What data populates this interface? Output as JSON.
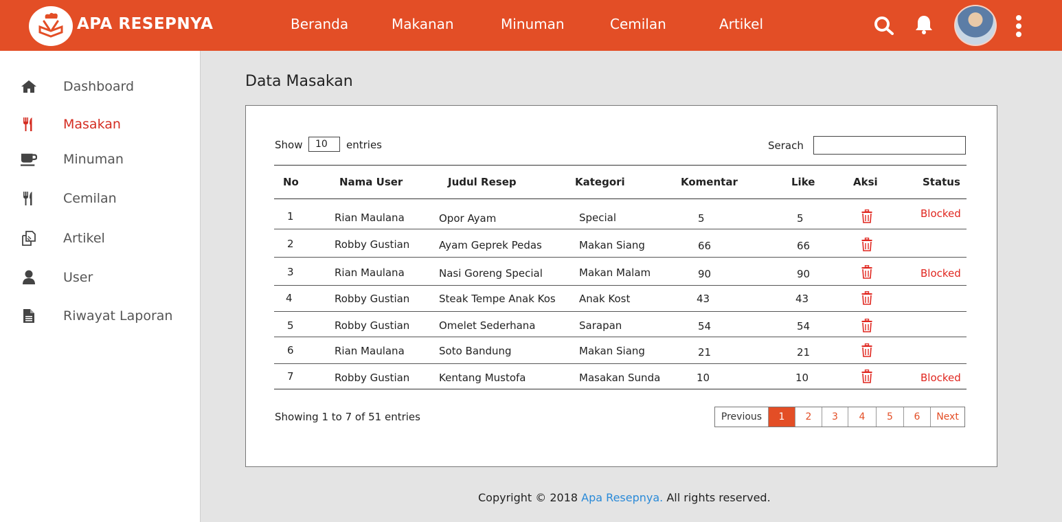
{
  "brand": {
    "name": "APA RESEPNYA"
  },
  "nav": {
    "items": [
      "Beranda",
      "Makanan",
      "Minuman",
      "Cemilan",
      "Artikel"
    ]
  },
  "topbar": {
    "icons": [
      "search-icon",
      "bell-icon",
      "avatar",
      "more-vertical-icon"
    ]
  },
  "sidebar": {
    "items": [
      {
        "label": "Dashboard",
        "icon": "home-icon",
        "active": false
      },
      {
        "label": "Masakan",
        "icon": "utensils-icon",
        "active": true
      },
      {
        "label": "Minuman",
        "icon": "coffee-cup-icon",
        "active": false
      },
      {
        "label": "Cemilan",
        "icon": "utensils-icon",
        "active": false
      },
      {
        "label": "Artikel",
        "icon": "copy-documents-icon",
        "active": false
      },
      {
        "label": "User",
        "icon": "user-icon",
        "active": false
      },
      {
        "label": "Riwayat Laporan",
        "icon": "file-text-icon",
        "active": false
      }
    ]
  },
  "page": {
    "title": "Data Masakan"
  },
  "table_controls": {
    "show_label": "Show",
    "entries_value": "10",
    "entries_label": "entries",
    "search_label": "Serach",
    "search_value": ""
  },
  "table": {
    "columns": [
      "No",
      "Nama User",
      "Judul Resep",
      "Kategori",
      "Komentar",
      "Like",
      "Aksi",
      "Status"
    ],
    "rows": [
      {
        "no": "1",
        "user": "Rian Maulana",
        "judul": "Opor Ayam",
        "kategori": "Special",
        "komentar": "5",
        "like": "5",
        "status": "Blocked"
      },
      {
        "no": "2",
        "user": "Robby Gustian",
        "judul": "Ayam Geprek Pedas",
        "kategori": "Makan Siang",
        "komentar": "66",
        "like": "66",
        "status": ""
      },
      {
        "no": "3",
        "user": "Rian Maulana",
        "judul": "Nasi Goreng Special",
        "kategori": "Makan Malam",
        "komentar": "90",
        "like": "90",
        "status": "Blocked"
      },
      {
        "no": "4",
        "user": "Robby Gustian",
        "judul": "Steak Tempe Anak Kos",
        "kategori": "Anak Kost",
        "komentar": "43",
        "like": "43",
        "status": ""
      },
      {
        "no": "5",
        "user": "Robby Gustian",
        "judul": "Omelet Sederhana",
        "kategori": "Sarapan",
        "komentar": "54",
        "like": "54",
        "status": ""
      },
      {
        "no": "6",
        "user": "Rian Maulana",
        "judul": "Soto Bandung",
        "kategori": "Makan Siang",
        "komentar": "21",
        "like": "21",
        "status": ""
      },
      {
        "no": "7",
        "user": "Robby Gustian",
        "judul": "Kentang Mustofa",
        "kategori": "Masakan Sunda",
        "komentar": "10",
        "like": "10",
        "status": "Blocked"
      }
    ],
    "action_icon": "trash-icon"
  },
  "pagination": {
    "summary": "Showing 1 to 7 of 51 entries",
    "previous": "Previous",
    "pages": [
      "1",
      "2",
      "3",
      "4",
      "5",
      "6"
    ],
    "current": "1",
    "next": "Next"
  },
  "footer": {
    "prefix": "Copyright © 2018",
    "brand": "Apa Resepnya.",
    "suffix": "All rights reserved."
  },
  "colors": {
    "accent": "#e34e26",
    "active_sidebar": "#d42d22",
    "blocked": "#e0261f",
    "footer_link": "#2a8ad8"
  }
}
